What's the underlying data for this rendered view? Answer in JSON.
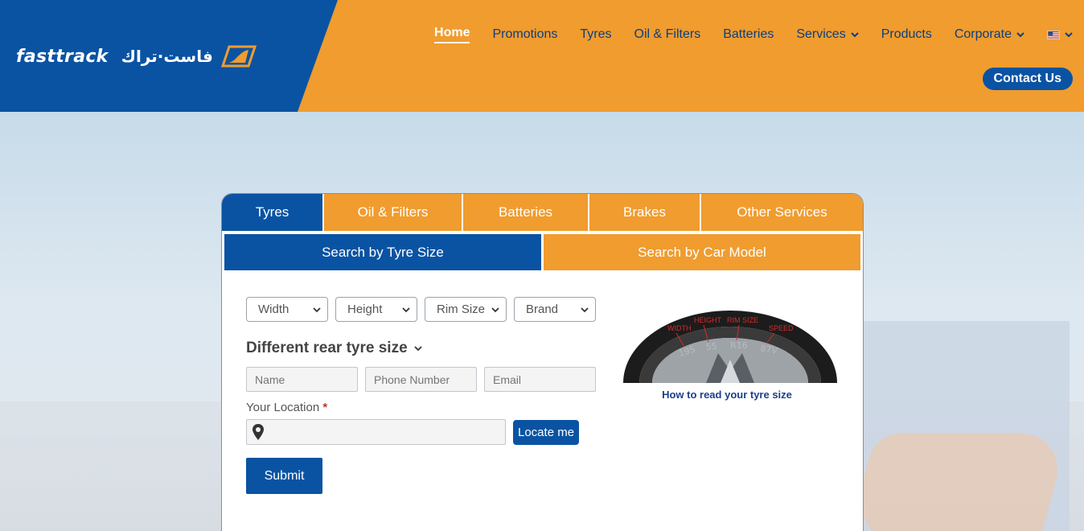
{
  "header": {
    "logo": {
      "text_en": "fasttrack",
      "text_ar": "فاست·تراك",
      "icon": "fasttrack-logo-icon"
    },
    "nav": [
      {
        "label": "Home",
        "active": true
      },
      {
        "label": "Promotions"
      },
      {
        "label": "Tyres"
      },
      {
        "label": "Oil & Filters"
      },
      {
        "label": "Batteries"
      },
      {
        "label": "Services",
        "dropdown": true
      },
      {
        "label": "Products"
      },
      {
        "label": "Corporate",
        "dropdown": true
      }
    ],
    "language_icon": "us-flag-icon",
    "contact_label": "Contact Us",
    "colors": {
      "blue": "#0a53a3",
      "orange": "#f09c2f"
    }
  },
  "search": {
    "tabs": [
      "Tyres",
      "Oil & Filters",
      "Batteries",
      "Brakes",
      "Other Services"
    ],
    "active_tab": "Tyres",
    "subtabs": [
      "Search by Tyre Size",
      "Search by Car Model"
    ],
    "active_subtab": "Search by Tyre Size",
    "selects": [
      "Width",
      "Height",
      "Rim Size",
      "Brand"
    ],
    "rear_toggle": "Different rear tyre size",
    "inputs": {
      "name_placeholder": "Name",
      "phone_placeholder": "Phone Number",
      "email_placeholder": "Email"
    },
    "location_label": "Your Location",
    "location_required": "*",
    "locate_label": "Locate me",
    "submit_label": "Submit",
    "tyre_diagram": {
      "labels": [
        "WIDTH",
        "HEIGHT",
        "RIM SIZE",
        "SPEED"
      ],
      "values": [
        "195",
        "55",
        "R16",
        "87V"
      ],
      "caption": "How to read your tyre size"
    }
  }
}
